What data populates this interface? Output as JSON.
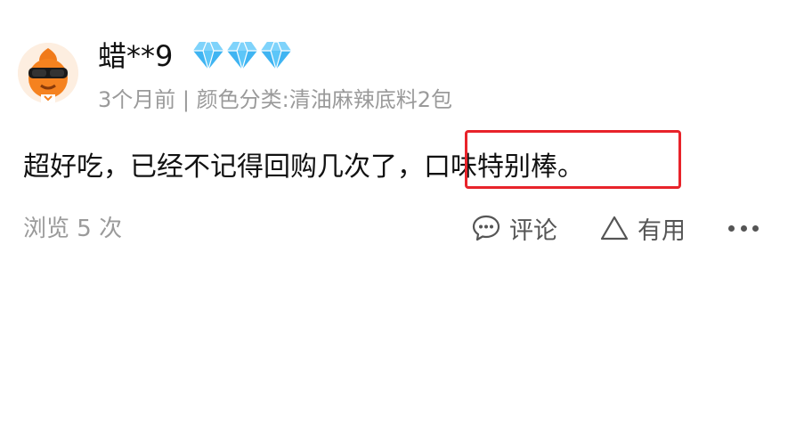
{
  "user": {
    "name": "蜡**9",
    "avatar_icon": "orange-mascot-sunglasses-icon",
    "badges": [
      "diamond-icon",
      "diamond-icon",
      "diamond-icon"
    ],
    "badge_color": "#3fb4f2"
  },
  "meta_text": "3个月前 | 颜色分类:清油麻辣底料2包",
  "comment": {
    "text_before": "超好吃，已经不记得回购几次了，",
    "text_highlighted": "口味特别棒。",
    "highlight_color": "#e8232a"
  },
  "footer": {
    "views": "浏览 5 次",
    "comment_label": "评论",
    "comment_icon": "chat-bubble-icon",
    "useful_label": "有用",
    "useful_icon": "triangle-icon",
    "more_icon": "more-dots-icon"
  }
}
